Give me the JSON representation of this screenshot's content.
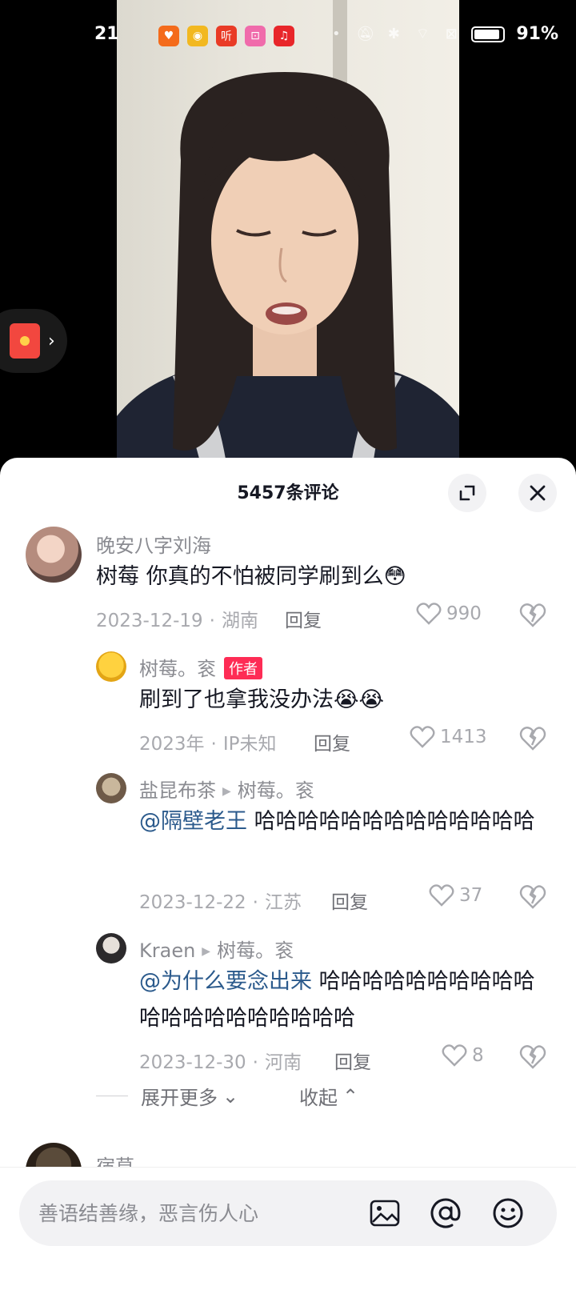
{
  "status_bar": {
    "time": "21",
    "battery_level": 0.91,
    "battery_text": "91%",
    "notification_icons": [
      {
        "name": "app-orange-icon",
        "color": "#f46b1b",
        "glyph": "♥"
      },
      {
        "name": "weibo-icon",
        "color": "#f2b820",
        "glyph": "◉"
      },
      {
        "name": "ximalaya-icon",
        "color": "#e93b26",
        "glyph": "听"
      },
      {
        "name": "bilibili-icon",
        "color": "#f06bab",
        "glyph": "⊡"
      },
      {
        "name": "music-icon",
        "color": "#e8262a",
        "glyph": "♫"
      }
    ]
  },
  "sheet": {
    "comment_count": "5457条评论"
  },
  "comments": [
    {
      "user": "晚安八字刘海",
      "text": "树莓 你真的不怕被同学刷到么😳",
      "date": "2023-12-19",
      "location": "湖南",
      "reply": "回复",
      "likes": "990"
    },
    {
      "user": "树莓。衮",
      "tag": "作者",
      "text": "刷到了也拿我没办法😭😭",
      "date": "2023年",
      "location": "IP未知",
      "reply": "回复",
      "likes": "1413"
    },
    {
      "user": "盐昆布茶",
      "reply_to": "树莓。衮",
      "mention": "@隔壁老王",
      "text": " 哈哈哈哈哈哈哈哈哈哈哈哈哈",
      "date": "2023-12-22",
      "location": "江苏",
      "reply": "回复",
      "likes": "37"
    },
    {
      "user": "Kraen",
      "reply_to": "树莓。衮",
      "mention": "@为什么要念出来",
      "text": " 哈哈哈哈哈哈哈哈哈哈哈哈哈哈哈哈哈哈哈哈",
      "date": "2023-12-30",
      "location": "河南",
      "reply": "回复",
      "likes": "8"
    }
  ],
  "expand": {
    "more": "展开更多",
    "collapse": "收起"
  },
  "next_comment": {
    "user": "宿草"
  },
  "input": {
    "placeholder": "善语结善缘，恶言伤人心"
  }
}
